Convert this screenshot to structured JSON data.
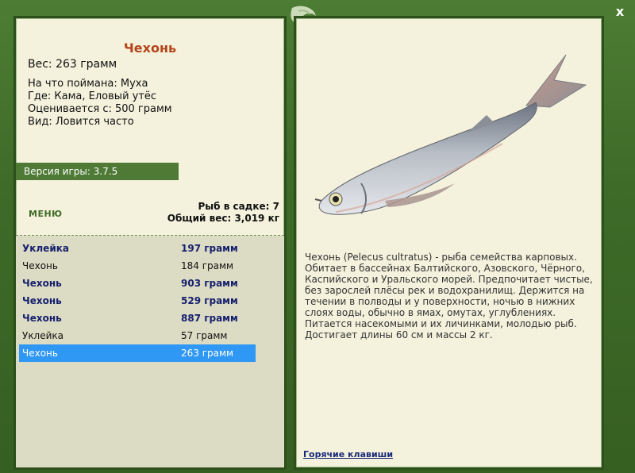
{
  "fish": {
    "name": "Чехонь",
    "weight_line": "Вес: 263 грамм",
    "caught_on": "На что поймана: Муха",
    "location": "Где: Кама, Еловый утёс",
    "valued_from": "Оценивается с: 500 грамм",
    "frequency": "Вид: Ловится часто"
  },
  "version": "Версия игры: 3.7.5",
  "menu_label": "МЕНЮ",
  "stats": {
    "count_line": "Рыб в садке: 7",
    "total_line": "Общий вес: 3,019 кг"
  },
  "catch_list": [
    {
      "name": "Уклейка",
      "weight": "197 грамм",
      "bold": true,
      "selected": false
    },
    {
      "name": "Чехонь",
      "weight": "184 грамм",
      "bold": false,
      "selected": false
    },
    {
      "name": "Чехонь",
      "weight": "903 грамм",
      "bold": true,
      "selected": false
    },
    {
      "name": "Чехонь",
      "weight": "529 грамм",
      "bold": true,
      "selected": false
    },
    {
      "name": "Чехонь",
      "weight": "887 грамм",
      "bold": true,
      "selected": false
    },
    {
      "name": "Уклейка",
      "weight": "57 грамм",
      "bold": false,
      "selected": false
    },
    {
      "name": "Чехонь",
      "weight": "263 грамм",
      "bold": false,
      "selected": true
    }
  ],
  "description": "Чехонь (Pelecus cultratus) - рыба семейства карповых. Обитает в бассейнах Балтийского, Азовского, Чёрного, Каспийского и Уральского морей. Предпочитает чистые, без зарослей плёсы рек и водохранилищ. Держится на течении в полводы и у поверхности, ночью в нижних слоях воды, обычно в ямах, омутах, углублениях. Питается насекомыми и их личинками, молодью рыб. Достигает длины 60 см и массы 2 кг.",
  "hotkeys_label": "Горячие клавиши",
  "close_label": "x",
  "icons": {
    "close": "close-icon",
    "emblem": "fish-emblem-icon",
    "fish": "sabrefish-image"
  },
  "colors": {
    "frame": "#3e6b28",
    "panel": "#f4f2dc",
    "title": "#b5451b",
    "selected_row": "#2f97f4",
    "bold_row_text": "#16206e"
  }
}
